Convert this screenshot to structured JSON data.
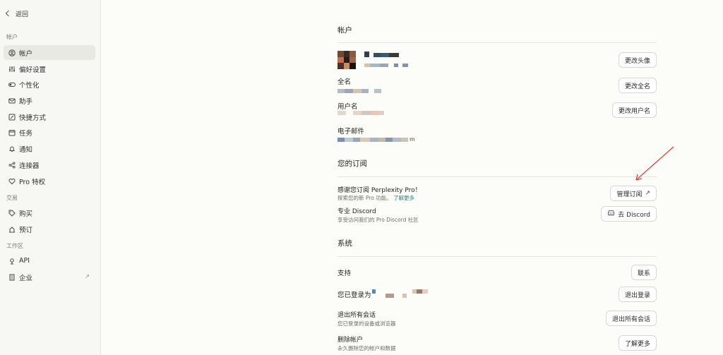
{
  "sidebar": {
    "back_label": "返回",
    "groups": [
      {
        "label": "帐户"
      },
      {
        "label": "交易"
      },
      {
        "label": "工作区"
      }
    ],
    "items": [
      {
        "label": "帐户",
        "icon": "user-circle-icon",
        "active": true
      },
      {
        "label": "偏好设置",
        "icon": "sliders-icon"
      },
      {
        "label": "个性化",
        "icon": "toggle-icon"
      },
      {
        "label": "助手",
        "icon": "mail-icon"
      },
      {
        "label": "快捷方式",
        "icon": "edit-square-icon"
      },
      {
        "label": "任务",
        "icon": "calendar-task-icon"
      },
      {
        "label": "通知",
        "icon": "bell-icon"
      },
      {
        "label": "连接器",
        "icon": "share-nodes-icon"
      },
      {
        "label": "Pro 特权",
        "icon": "heart-badge-icon"
      },
      {
        "label": "购买",
        "icon": "tag-icon"
      },
      {
        "label": "预订",
        "icon": "booking-icon"
      },
      {
        "label": "API",
        "icon": "api-icon"
      },
      {
        "label": "企业",
        "icon": "building-icon"
      }
    ]
  },
  "account": {
    "title": "帐户",
    "change_avatar": "更改头像",
    "fullname_label": "全名",
    "change_fullname": "更改全名",
    "username_label": "用户名",
    "change_username": "更改用户名",
    "email_label": "电子邮件",
    "email_tail": "m"
  },
  "subscription": {
    "title": "您的订阅",
    "thanks": "感谢您订阅 Perplexity Pro！",
    "explore": "探索您的新 Pro 功能。",
    "learn_more": "了解更多",
    "manage": "管理订阅",
    "discord_title": "专业 Discord",
    "discord_sub": "享受访问我们的 Pro Discord 社区",
    "discord_btn": "去 Discord"
  },
  "system": {
    "title": "系统",
    "support": "支持",
    "contact": "联系",
    "logged_in_as": "您已登录为",
    "logout": "退出登录",
    "logout_all_title": "退出所有会话",
    "logout_all_sub": "您已登录的设备或浏览器",
    "logout_all_btn": "退出所有会话",
    "delete_title": "删除帐户",
    "delete_sub": "永久删除您的帐户和数据",
    "delete_btn": "了解更多"
  },
  "colors": {
    "accent_link": "#1a8a8e",
    "annotation_arrow": "#e0443c"
  }
}
